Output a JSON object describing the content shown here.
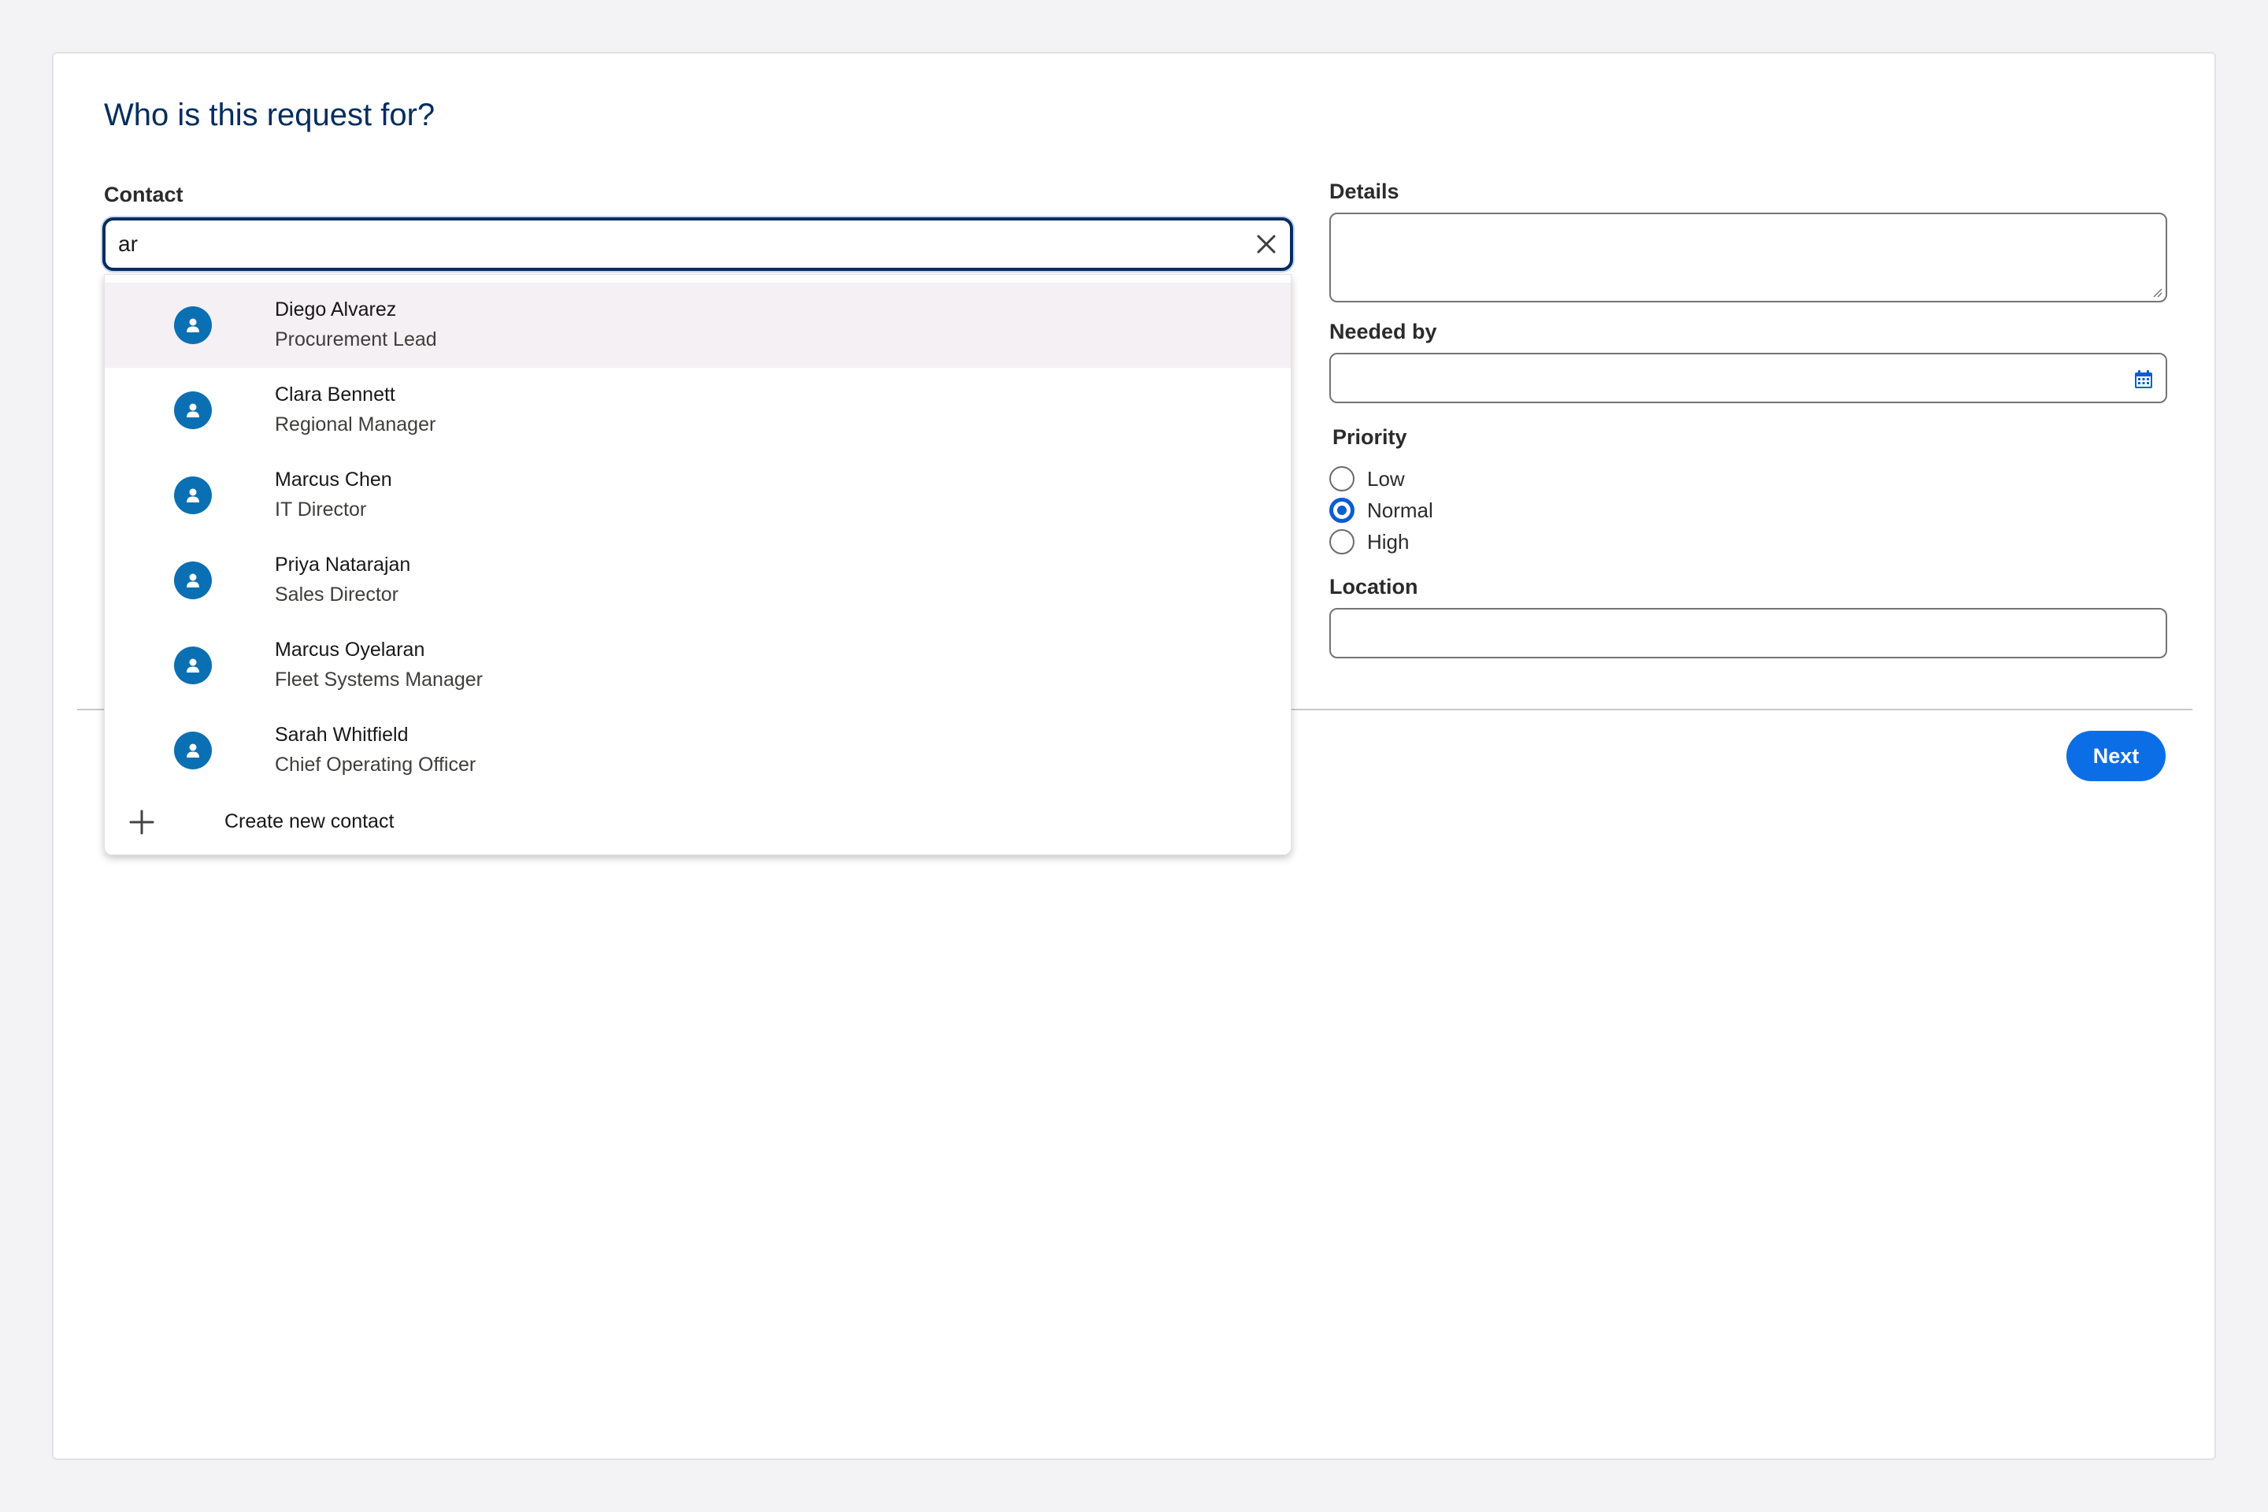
{
  "page": {
    "title": "Who is this request for?"
  },
  "contact": {
    "label": "Contact",
    "value": "ar",
    "options": [
      {
        "name": "Diego Alvarez",
        "subtitle": "Procurement Lead",
        "active": true
      },
      {
        "name": "Clara Bennett",
        "subtitle": "Regional Manager"
      },
      {
        "name": "Marcus Chen",
        "subtitle": "IT Director"
      },
      {
        "name": "Priya Natarajan",
        "subtitle": "Sales Director"
      },
      {
        "name": "Marcus Oyelaran",
        "subtitle": "Fleet Systems Manager"
      },
      {
        "name": "Sarah Whitfield",
        "subtitle": "Chief Operating Officer"
      }
    ],
    "create_label": "Create new contact"
  },
  "details": {
    "label": "Details",
    "value": ""
  },
  "needed_by": {
    "label": "Needed by",
    "value": ""
  },
  "priority": {
    "label": "Priority",
    "options": [
      "Low",
      "Normal",
      "High"
    ],
    "selected": "Normal"
  },
  "location": {
    "label": "Location",
    "value": ""
  },
  "footer": {
    "next_label": "Next"
  },
  "colors": {
    "title": "#032d60",
    "avatar": "#0b6fb3",
    "accent": "#0b6ee6",
    "radio_selected": "#0b5cd5"
  }
}
